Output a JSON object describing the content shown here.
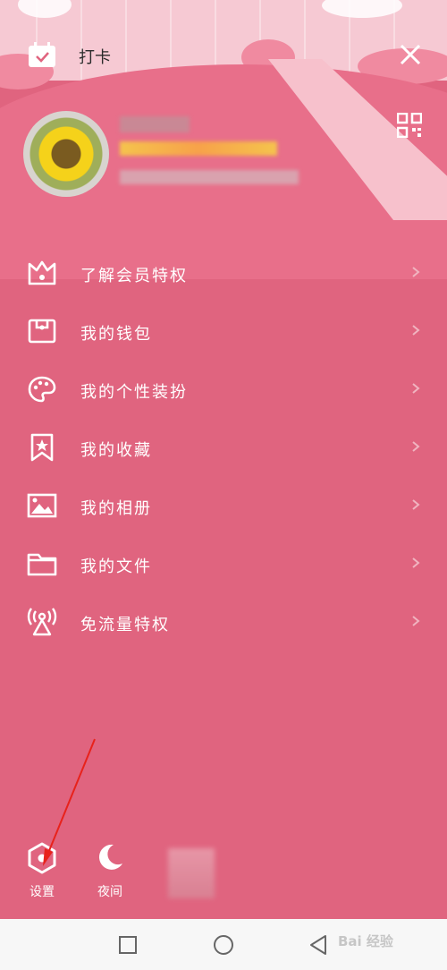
{
  "topbar": {
    "title": "打卡"
  },
  "menu": [
    {
      "label": "了解会员特权",
      "icon": "crown-icon"
    },
    {
      "label": "我的钱包",
      "icon": "wallet-icon"
    },
    {
      "label": "我的个性装扮",
      "icon": "palette-icon"
    },
    {
      "label": "我的收藏",
      "icon": "bookmark-star-icon"
    },
    {
      "label": "我的相册",
      "icon": "image-icon"
    },
    {
      "label": "我的文件",
      "icon": "folder-icon"
    },
    {
      "label": "免流量特权",
      "icon": "signal-tower-icon"
    }
  ],
  "bottom": {
    "settings_label": "设置",
    "night_label": "夜间"
  },
  "navbar": {
    "watermark": "Bai 经验"
  },
  "colors": {
    "background": "#e0647f",
    "text": "#ffffff",
    "annotation_arrow": "#e8221b"
  }
}
